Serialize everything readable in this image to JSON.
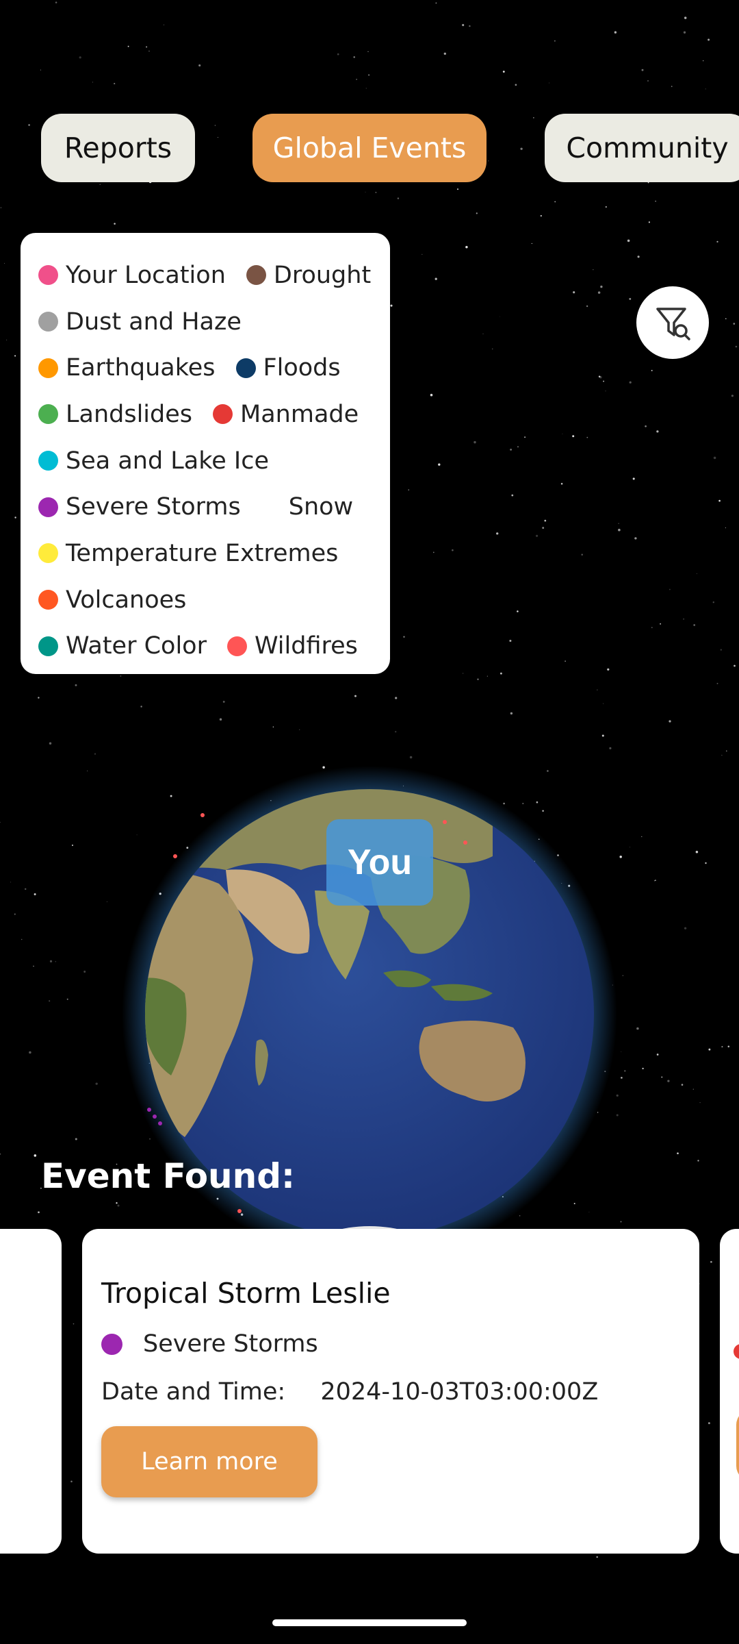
{
  "tabs": [
    {
      "label": "Reports",
      "active": false
    },
    {
      "label": "Global Events",
      "active": true
    },
    {
      "label": "Community",
      "active": false
    }
  ],
  "legend": [
    {
      "label": "Your Location",
      "color": "#f0508a"
    },
    {
      "label": "Drought",
      "color": "#7a5444"
    },
    {
      "label": "Dust and Haze",
      "color": "#a0a0a0"
    },
    {
      "label": "Earthquakes",
      "color": "#ff9800"
    },
    {
      "label": "Floods",
      "color": "#0d3b66"
    },
    {
      "label": "Landslides",
      "color": "#4caf50"
    },
    {
      "label": "Manmade",
      "color": "#e53935"
    },
    {
      "label": "Sea and Lake Ice",
      "color": "#00bcd4"
    },
    {
      "label": "Severe Storms",
      "color": "#9c27b0"
    },
    {
      "label": "Snow",
      "color": "#ffffff"
    },
    {
      "label": "Temperature Extremes",
      "color": "#ffeb3b"
    },
    {
      "label": "Volcanoes",
      "color": "#ff5722"
    },
    {
      "label": "Water Color",
      "color": "#009688"
    },
    {
      "label": "Wildfires",
      "color": "#ff5555"
    }
  ],
  "filter_button": {
    "icon": "filter-search-icon"
  },
  "globe": {
    "you_label": "You"
  },
  "events": {
    "heading": "Event Found:",
    "card": {
      "title": "Tropical Storm Leslie",
      "category": "Severe Storms",
      "category_color": "#9c27b0",
      "date_label": "Date and Time:",
      "date_value": "2024-10-03T03:00:00Z",
      "button_label": "Learn more"
    }
  },
  "colors": {
    "accent": "#e89c50",
    "tab_inactive": "#ebebe3",
    "background": "#000000"
  }
}
